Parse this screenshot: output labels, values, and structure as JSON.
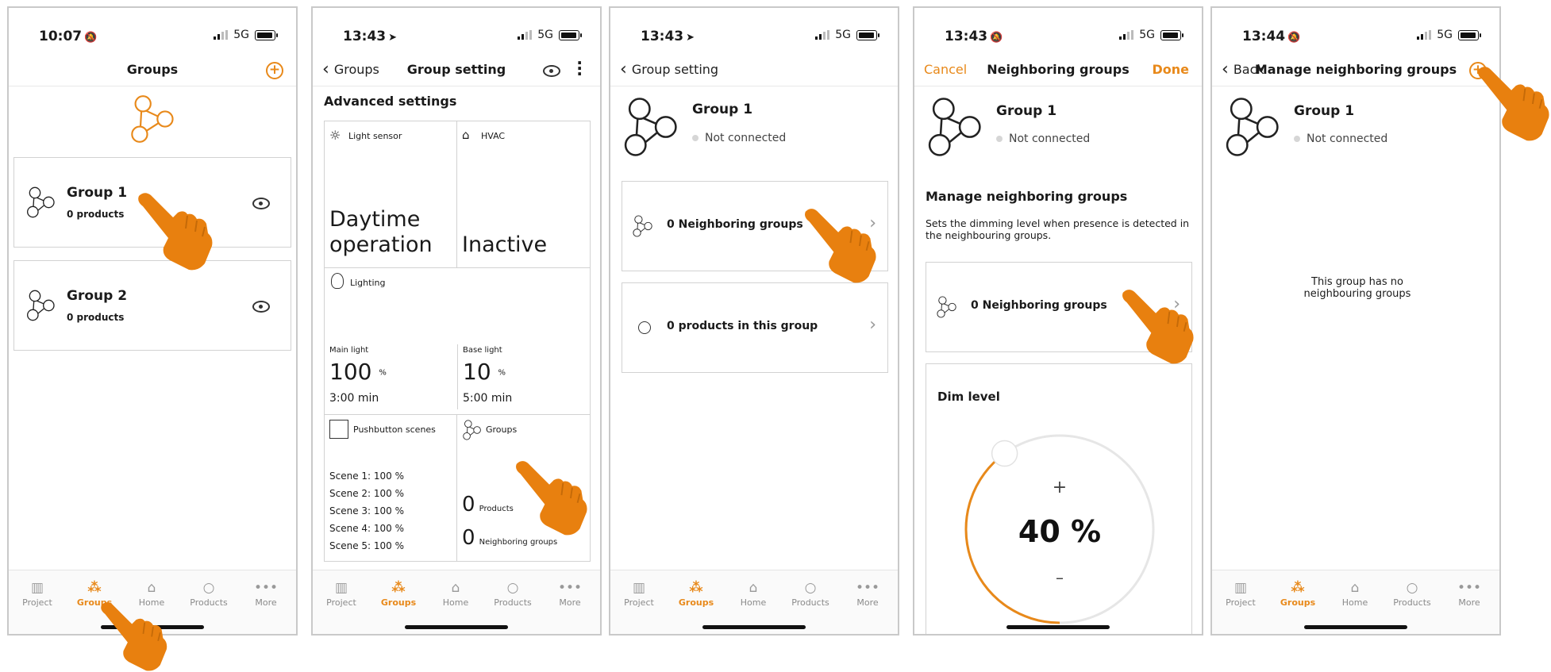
{
  "colors": {
    "accent": "#e8891a",
    "border": "#d2d2d2",
    "text": "#1a1a1a"
  },
  "tabs": [
    "Project",
    "Groups",
    "Home",
    "Products",
    "More"
  ],
  "screen1": {
    "time": "10:07",
    "network": "5G",
    "title": "Groups",
    "groups": [
      {
        "name": "Group 1",
        "products": "0 products"
      },
      {
        "name": "Group 2",
        "products": "0 products"
      }
    ]
  },
  "screen2": {
    "time": "13:43",
    "network": "5G",
    "back": "Groups",
    "title": "Group setting",
    "section": "Advanced settings",
    "light_sensor": {
      "label": "Light sensor",
      "value": "Daytime operation"
    },
    "hvac": {
      "label": "HVAC",
      "value": "Inactive"
    },
    "lighting": {
      "label": "Lighting",
      "main_label": "Main light",
      "main_value": "100",
      "main_unit": "%",
      "main_time": "3:00 min",
      "base_label": "Base light",
      "base_value": "10",
      "base_unit": "%",
      "base_time": "5:00 min"
    },
    "scenes": {
      "label": "Pushbutton scenes",
      "items": [
        "Scene 1: 100 %",
        "Scene 2: 100 %",
        "Scene 3: 100 %",
        "Scene 4: 100 %",
        "Scene 5: 100 %"
      ]
    },
    "groups": {
      "label": "Groups",
      "products_count": "0",
      "products_label": "Products",
      "neighbors_count": "0",
      "neighbors_label": "Neighboring groups"
    }
  },
  "screen3": {
    "time": "13:43",
    "network": "5G",
    "back": "Group setting",
    "group_name": "Group 1",
    "status": "Not connected",
    "neighbors": "0 Neighboring groups",
    "products": "0 products in this group"
  },
  "screen4": {
    "time": "13:43",
    "network": "5G",
    "cancel": "Cancel",
    "title": "Neighboring groups",
    "done": "Done",
    "group_name": "Group 1",
    "status": "Not connected",
    "section_title": "Manage neighboring groups",
    "description": "Sets the dimming level when presence is detected in the neighbouring groups.",
    "neighbors": "0 Neighboring groups",
    "dim_label": "Dim level",
    "dim_value": "40 %",
    "dim_fraction": 0.4,
    "plus": "+",
    "minus": "–"
  },
  "screen5": {
    "time": "13:44",
    "network": "5G",
    "back": "Back",
    "title": "Manage neighboring groups",
    "group_name": "Group 1",
    "status": "Not connected",
    "empty_message": "This group has no neighbouring groups"
  }
}
